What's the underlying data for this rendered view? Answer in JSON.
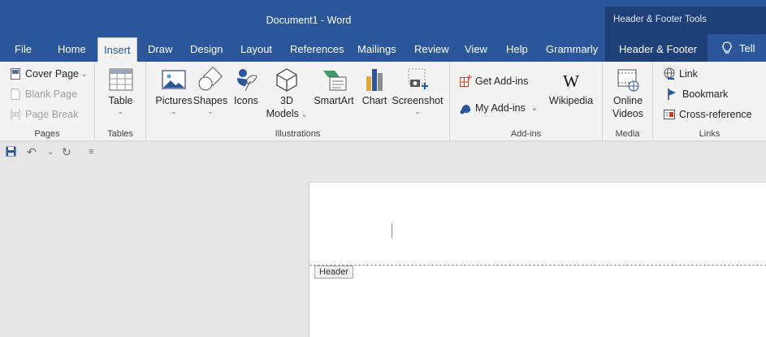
{
  "window": {
    "title": "Document1  -  Word",
    "context_tools": "Header & Footer Tools"
  },
  "tabs": {
    "file": "File",
    "home": "Home",
    "insert": "Insert",
    "draw": "Draw",
    "design": "Design",
    "layout": "Layout",
    "references": "References",
    "mailings": "Mailings",
    "review": "Review",
    "view": "View",
    "help": "Help",
    "grammarly": "Grammarly",
    "header_footer": "Header & Footer",
    "tell": "Tell"
  },
  "ribbon": {
    "pages": {
      "label": "Pages",
      "cover_page": "Cover Page",
      "blank_page": "Blank Page",
      "page_break": "Page Break"
    },
    "tables": {
      "label": "Tables",
      "table": "Table"
    },
    "illustrations": {
      "label": "Illustrations",
      "pictures": "Pictures",
      "shapes": "Shapes",
      "icons": "Icons",
      "models_line1": "3D",
      "models_line2": "Models",
      "smartart": "SmartArt",
      "chart": "Chart",
      "screenshot": "Screenshot"
    },
    "addins": {
      "label": "Add-ins",
      "get_addins": "Get Add-ins",
      "my_addins": "My Add-ins",
      "wikipedia": "Wikipedia"
    },
    "media": {
      "label": "Media",
      "online_line1": "Online",
      "online_line2": "Videos"
    },
    "links": {
      "label": "Links",
      "link": "Link",
      "bookmark": "Bookmark",
      "cross_reference": "Cross-reference"
    }
  },
  "document": {
    "header_tag": "Header"
  },
  "colors": {
    "accent": "#2b579a",
    "context_tab": "#1e4078",
    "ribbon_bg": "#f3f3f3"
  }
}
